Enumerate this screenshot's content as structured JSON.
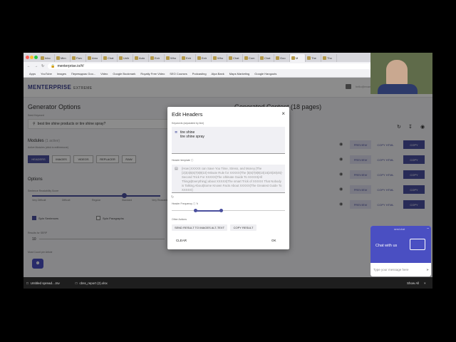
{
  "browser": {
    "tabs": [
      "Inbo",
      "Mlm",
      "Parv",
      "Amo",
      "Chat",
      "Unlir",
      "Auto",
      "Extr",
      "Who",
      "Extr",
      "Extr",
      "Who",
      "Chat",
      "Com",
      "Chat",
      "Goo",
      "M",
      "The",
      "Tho"
    ],
    "url": "menterprise.io/#/",
    "bookmarks": [
      "Apps",
      "YouTube",
      "Images",
      "Переводчик Goo...",
      "Video",
      "Google Bookmark",
      "Royalty Free Video",
      "SEO Courses",
      "Podcasting",
      "Alpa Bank",
      "Maps Marketing",
      "Google Hangouts"
    ]
  },
  "app": {
    "logo": "MENTERPRISE",
    "logo_sub": "EXTREME",
    "user_email": "hello@example.com",
    "gen_title": "Generator Options",
    "keyword_label": "Seed Keyword",
    "keyword_value": "best tire shine products or tire shine spray?",
    "modules_label": "Modules",
    "modules_count": "(1 active)",
    "modules_hint": "Active Modules (click to edit/remove)",
    "module_chips": [
      "HEADERS",
      "IMAGES",
      "VIDEOS",
      "REPLACER",
      "RAW"
    ],
    "options_label": "Options",
    "options_sub": "Sentence Readability Score",
    "slider_labels": [
      "Very Difficult",
      "Difficult",
      "Regular",
      "Standard",
      "Very Readable"
    ],
    "spin_sentences": "Spin Sentences",
    "spin_paragraphs": "Spin Paragraphs",
    "results_label": "Results for SERP",
    "results_value": "10",
    "most_label": "Most Count per Article",
    "generated_title": "Generated Content (18 pages)",
    "row_buttons": [
      "PREVIEW",
      "COPY HTML",
      "COPY"
    ],
    "row_count": 5
  },
  "modal": {
    "title": "Edit Headers",
    "keywords_label": "Keywords (separated by line)",
    "keywords": [
      "tire shine",
      "tire shine spray"
    ],
    "template_label": "Header template",
    "template_text": "{How |XXXXX can Save You Time, Stress, and Money.|The {2|3|4|5|6|7|8|9|10}-Minute Rule for XXXXX|The {5|6|7|8|9|10|15|20|30|45}-Second Trick For XXXXX|The Ultimate Guide To XXXXX|All Things|Everything} about XXXXX|The smart Trick of XXXXX That Nobody is Talking About|Some Known Facts About XXXXX|The Greatest Guide To XXXXX}",
    "frequency_label": "Header Frequency",
    "other_label": "Other Actions",
    "send_btn": "SEND RESULT TO IMAGES ALT-TEXT",
    "copy_btn": "COPY RESULT",
    "clear_btn": "CLEAR",
    "ok_btn": "OK"
  },
  "chat": {
    "header": "send chat",
    "title": "Chat with us",
    "placeholder": "Type your message here"
  },
  "taskbar": {
    "files": [
      "Untitled spread....tsv",
      "cbss_report (2).xlsx"
    ],
    "show_all": "Show All"
  },
  "colors": {
    "accent": "#4a4f9e",
    "chat": "#4a4fc2"
  }
}
